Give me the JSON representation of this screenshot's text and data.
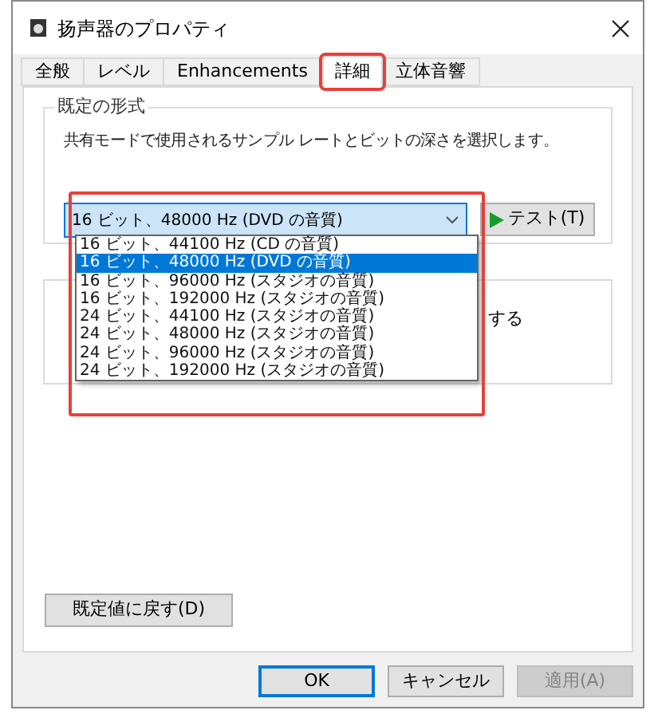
{
  "window": {
    "title": "扬声器のプロパティ"
  },
  "tabs": [
    {
      "label": "全般",
      "selected": false,
      "highlighted": false
    },
    {
      "label": "レベル",
      "selected": false,
      "highlighted": false
    },
    {
      "label": "Enhancements",
      "selected": false,
      "highlighted": false
    },
    {
      "label": "詳細",
      "selected": true,
      "highlighted": true
    },
    {
      "label": "立体音響",
      "selected": false,
      "highlighted": false
    }
  ],
  "default_format": {
    "title": "既定の形式",
    "description": "共有モードで使用されるサンプル レートとビットの深さを選択します。",
    "value": "16 ビット、48000 Hz (DVD の音質)",
    "expanded": true,
    "highlighted": true,
    "options": [
      {
        "label": "16 ビット、44100 Hz (CD の音質)",
        "selected": false
      },
      {
        "label": "16 ビット、48000 Hz (DVD の音質)",
        "selected": true
      },
      {
        "label": "16 ビット、96000 Hz (スタジオの音質)",
        "selected": false
      },
      {
        "label": "16 ビット、192000 Hz (スタジオの音質)",
        "selected": false
      },
      {
        "label": "24 ビット、44100 Hz (スタジオの音質)",
        "selected": false
      },
      {
        "label": "24 ビット、48000 Hz (スタジオの音質)",
        "selected": false
      },
      {
        "label": "24 ビット、96000 Hz (スタジオの音質)",
        "selected": false
      },
      {
        "label": "24 ビット、192000 Hz (スタジオの音質)",
        "selected": false
      }
    ],
    "test_button": "テスト(T)"
  },
  "exclusive_mode": {
    "text_fragment": "する"
  },
  "restore_defaults_button": "既定値に戻す(D)",
  "buttons": [
    {
      "label": "OK",
      "disabled": false,
      "default": true
    },
    {
      "label": "キャンセル",
      "disabled": false,
      "default": false
    },
    {
      "label": "適用(A)",
      "disabled": true,
      "default": false
    }
  ]
}
